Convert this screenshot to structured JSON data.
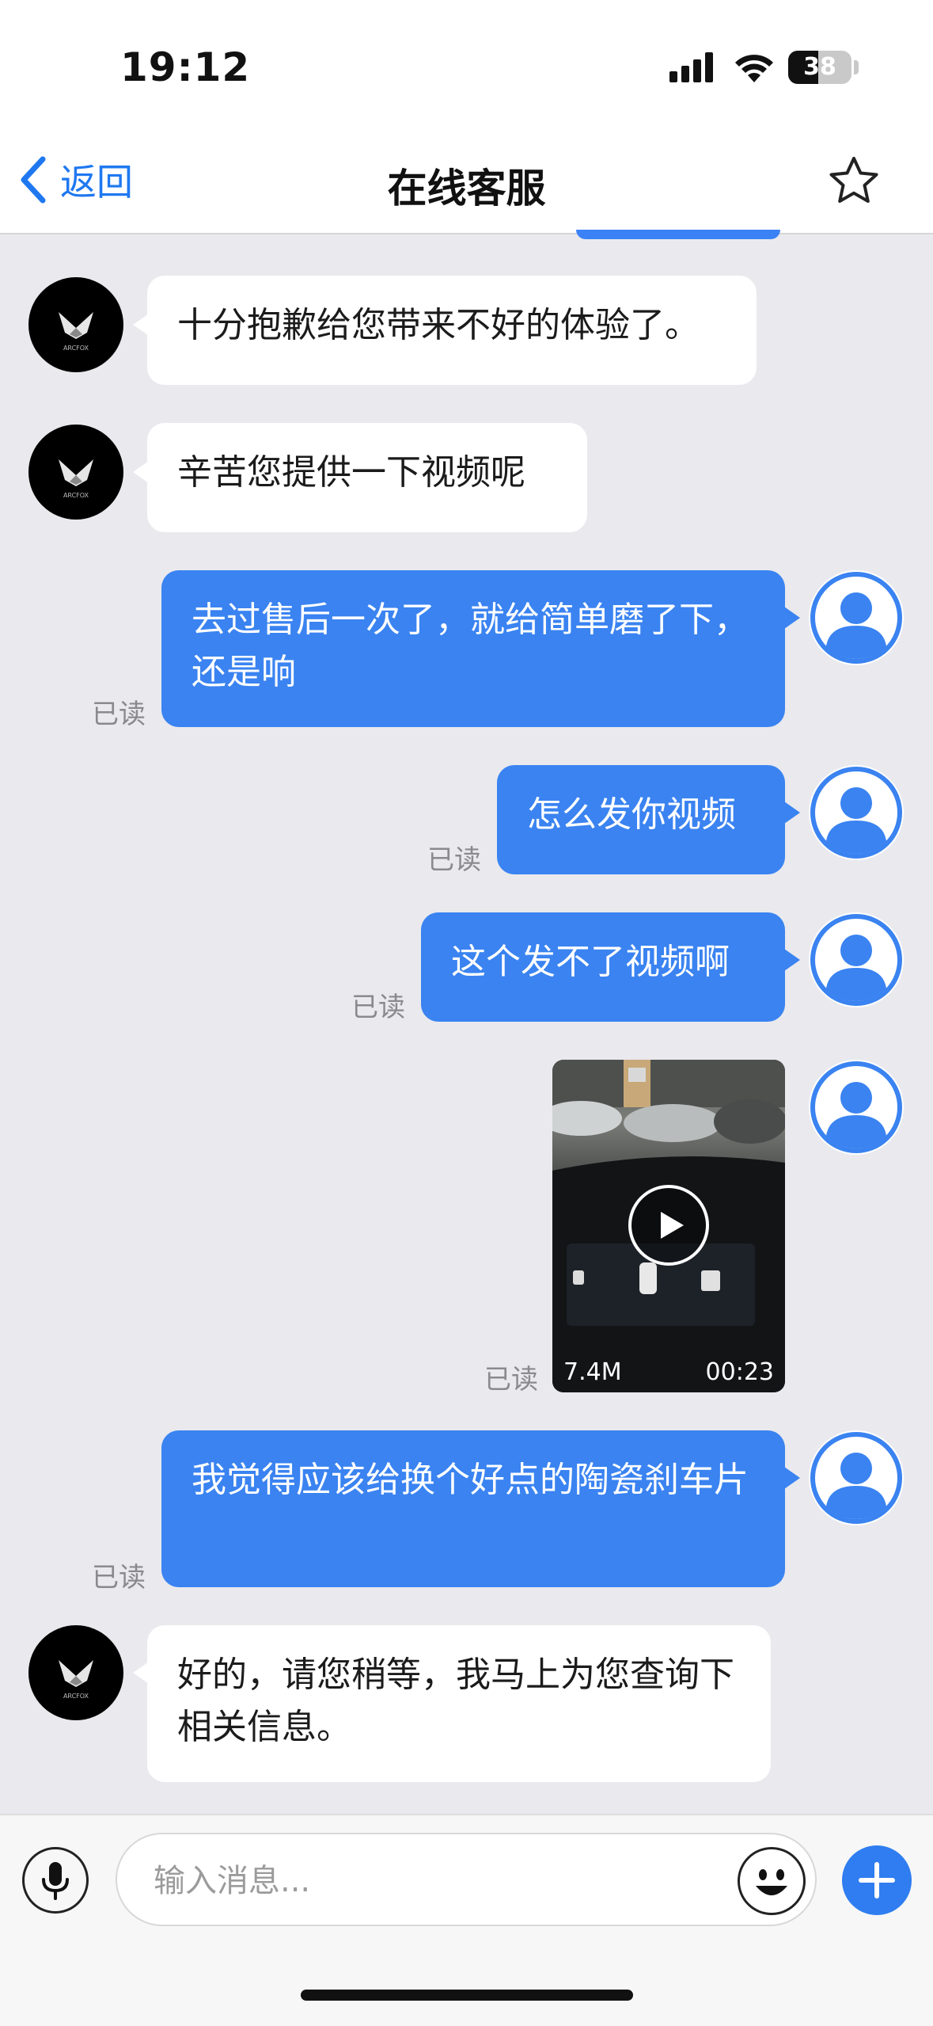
{
  "status": {
    "time": "19:12",
    "battery": "38"
  },
  "nav": {
    "back_label": "返回",
    "title": "在线客服"
  },
  "agent_brand": "ARCFOX",
  "messages": [
    {
      "from": "agent",
      "text": "十分抱歉给您带来不好的体验了。"
    },
    {
      "from": "agent",
      "text": "辛苦您提供一下视频呢"
    },
    {
      "from": "user",
      "text": "去过售后一次了，就给简单磨了下，还是响",
      "read": "已读"
    },
    {
      "from": "user",
      "text": "怎么发你视频",
      "read": "已读"
    },
    {
      "from": "user",
      "text": "这个发不了视频啊",
      "read": "已读"
    },
    {
      "from": "user",
      "type": "video",
      "size": "7.4M",
      "duration": "00:23",
      "read": "已读"
    },
    {
      "from": "user",
      "text": "我觉得应该给换个好点的陶瓷刹车片",
      "read": "已读"
    },
    {
      "from": "agent",
      "text": "好的，请您稍等，我马上为您查询下相关信息。"
    }
  ],
  "input": {
    "placeholder": "输入消息..."
  },
  "colors": {
    "accent": "#1f78f0",
    "out_bubble": "#3a83f1",
    "background": "#e9e9ee"
  }
}
